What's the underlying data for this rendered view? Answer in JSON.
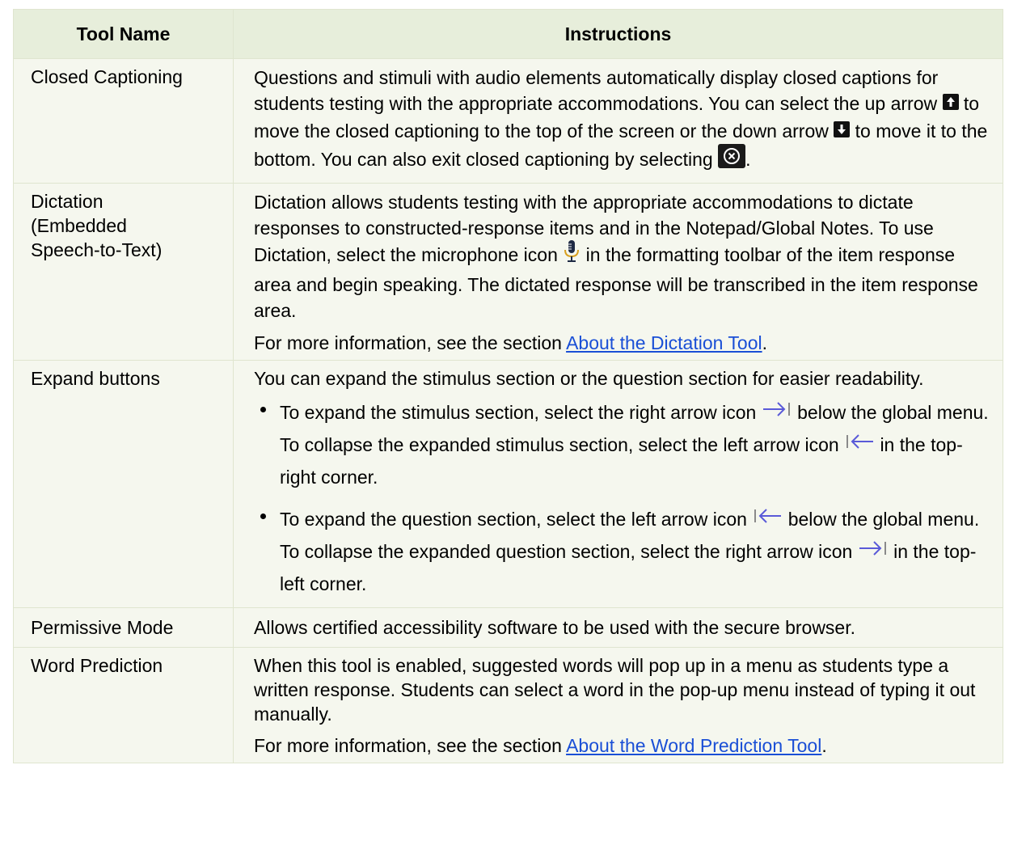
{
  "table": {
    "headers": {
      "tool_name": "Tool Name",
      "instructions": "Instructions"
    },
    "rows": {
      "closed_captioning": {
        "name": "Closed Captioning",
        "t1": "Questions and stimuli with audio elements automatically display closed captions for students testing with the appropriate accommodations. You can select the up arrow",
        "t2": "to move the closed captioning to the top of the screen or the down arrow",
        "t3": "to move it to the bottom. You can also exit closed captioning by selecting",
        "t4": "."
      },
      "dictation": {
        "name_1": "Dictation",
        "name_2": "(Embedded",
        "name_3": "Speech-to-Text)",
        "t1": "Dictation allows students testing with the appropriate accommodations to dictate responses to constructed-response items and in the Notepad/Global Notes. To use Dictation, select the microphone icon",
        "t2": "in the formatting toolbar of the item response area and begin speaking. The dictated response will be transcribed in the item response area.",
        "more_prefix": "For more information, see the section",
        "link": "About the Dictation Tool",
        "more_suffix": "."
      },
      "expand_buttons": {
        "name": "Expand buttons",
        "intro": "You can expand the stimulus section or the question section for easier readability.",
        "b1_t1": "To expand the stimulus section, select the right arrow icon",
        "b1_t2": "below the global menu. To collapse the expanded stimulus section, select the left arrow icon",
        "b1_t3": "in the top-right corner.",
        "b2_t1": "To expand the question section, select the left arrow icon",
        "b2_t2": "below the global menu. To collapse the expanded question section, select the right arrow icon",
        "b2_t3": "in the top-left corner."
      },
      "permissive_mode": {
        "name": "Permissive Mode",
        "text": "Allows certified accessibility software to be used with the secure browser."
      },
      "word_prediction": {
        "name": "Word Prediction",
        "text": "When this tool is enabled, suggested words will pop up in a menu as students type a written response. Students can select a word in the pop-up menu instead of typing it out manually.",
        "more_prefix": "For more information, see the section",
        "link": "About the Word Prediction Tool",
        "more_suffix": "."
      }
    }
  },
  "colors": {
    "header_bg": "#e7eedb",
    "row_bg": "#f5f7ee",
    "border": "#dfe5cf",
    "link": "#1a4fd6",
    "arrow_icon": "#5a5ad8"
  }
}
